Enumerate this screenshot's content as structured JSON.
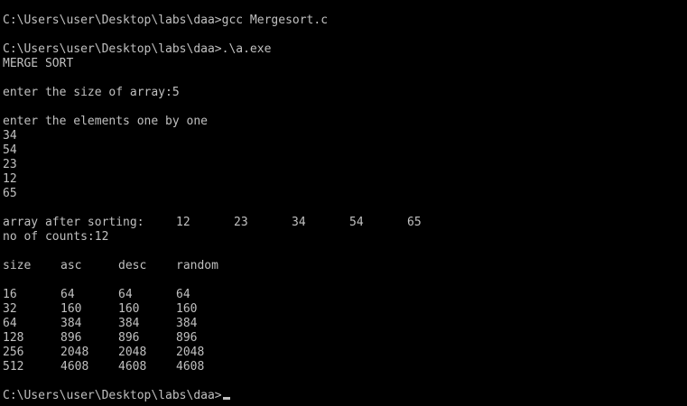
{
  "console": {
    "cmd_compile": "C:\\Users\\user\\Desktop\\labs\\daa>gcc Mergesort.c",
    "cmd_run": "C:\\Users\\user\\Desktop\\labs\\daa>.\\a.exe",
    "title": "MERGE SORT",
    "size_prompt": "enter the size of array:5",
    "elements_prompt": "enter the elements one by one",
    "inputs": [
      "34",
      "54",
      "23",
      "12",
      "65"
    ],
    "sorted_label": "array after sorting:",
    "sorted_values": [
      "12",
      "23",
      "34",
      "54",
      "65"
    ],
    "counts": "no of counts:12",
    "table": {
      "headers": [
        "size",
        "asc",
        "desc",
        "random"
      ],
      "rows": [
        [
          "16",
          "64",
          "64",
          "64"
        ],
        [
          "32",
          "160",
          "160",
          "160"
        ],
        [
          "64",
          "384",
          "384",
          "384"
        ],
        [
          "128",
          "896",
          "896",
          "896"
        ],
        [
          "256",
          "2048",
          "2048",
          "2048"
        ],
        [
          "512",
          "4608",
          "4608",
          "4608"
        ]
      ]
    },
    "final_prompt": "C:\\Users\\user\\Desktop\\labs\\daa>"
  },
  "colors": {
    "background": "#000000",
    "text": "#c0c0c0"
  }
}
